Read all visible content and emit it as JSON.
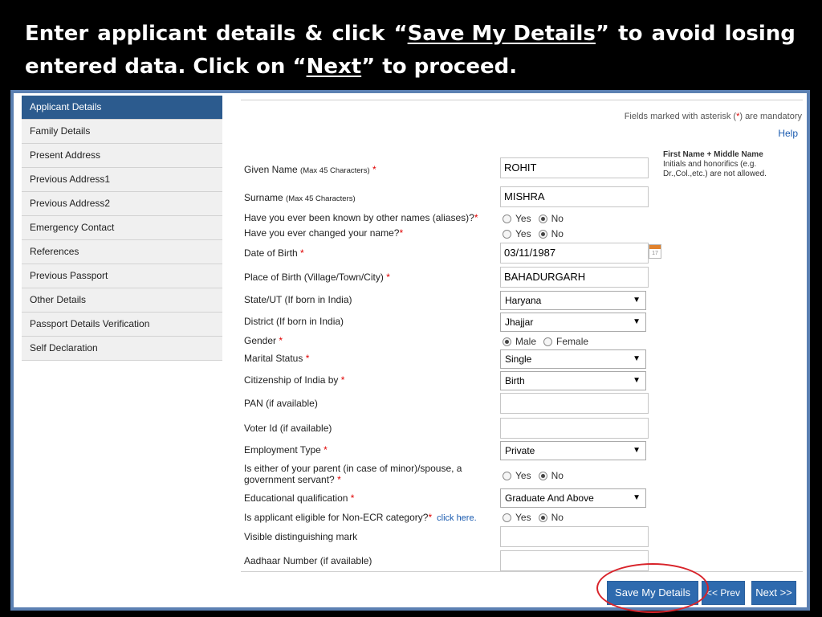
{
  "banner": {
    "line1_words": [
      "Enter",
      "applicant",
      "details",
      "&",
      "click",
      "“",
      "Save My Details",
      "”",
      "to",
      "avoid",
      "losing"
    ],
    "line2_pre": "entered data. Click on “",
    "line2_link": "Next",
    "line2_post": "” to proceed."
  },
  "sidebar": {
    "items": [
      {
        "label": "Applicant Details",
        "active": true
      },
      {
        "label": "Family Details"
      },
      {
        "label": "Present Address"
      },
      {
        "label": "Previous Address1"
      },
      {
        "label": "Previous Address2"
      },
      {
        "label": "Emergency Contact"
      },
      {
        "label": "References"
      },
      {
        "label": "Previous Passport"
      },
      {
        "label": "Other Details"
      },
      {
        "label": "Passport Details Verification"
      },
      {
        "label": "Self Declaration"
      }
    ]
  },
  "header": {
    "mandatory_pre": "Fields marked with asterisk (",
    "mandatory_ast": "*",
    "mandatory_post": ") are mandatory",
    "help": "Help"
  },
  "note": {
    "title": "First Name + Middle Name",
    "body": "Initials and honorifics (e.g. Dr.,Col.,etc.) are not allowed."
  },
  "form": {
    "given_name": {
      "label": "Given Name",
      "hint": "(Max 45 Characters)",
      "value": "ROHIT"
    },
    "surname": {
      "label": "Surname",
      "hint": "(Max 45 Characters)",
      "value": "MISHRA"
    },
    "aliases": {
      "label": "Have you ever been known by other names (aliases)?",
      "selected": "No"
    },
    "changed_name": {
      "label": "Have you ever changed your name?",
      "selected": "No"
    },
    "dob": {
      "label": "Date of Birth",
      "value": "03/11/1987",
      "calendar_icon": "calendar-icon"
    },
    "place_of_birth": {
      "label": "Place of Birth (Village/Town/City)",
      "value": "BAHADURGARH"
    },
    "state": {
      "label": "State/UT (If born in India)",
      "value": "Haryana"
    },
    "district": {
      "label": "District (If born in India)",
      "value": "Jhajjar"
    },
    "gender": {
      "label": "Gender",
      "options": [
        "Male",
        "Female"
      ],
      "selected": "Male"
    },
    "marital_status": {
      "label": "Marital Status",
      "value": "Single"
    },
    "citizenship": {
      "label": "Citizenship of India by",
      "value": "Birth"
    },
    "pan": {
      "label": "PAN (if available)",
      "value": ""
    },
    "voter_id": {
      "label": "Voter Id (if available)",
      "value": ""
    },
    "employment": {
      "label": "Employment Type",
      "value": "Private"
    },
    "parent_govt": {
      "label": "Is either of your parent (in case of minor)/spouse, a government servant?",
      "selected": "No"
    },
    "education": {
      "label": "Educational qualification",
      "value": "Graduate And Above"
    },
    "non_ecr": {
      "label": "Is applicant eligible for Non-ECR category?",
      "link": "click here.",
      "selected": "No"
    },
    "mark": {
      "label": "Visible distinguishing mark",
      "value": ""
    },
    "aadhaar": {
      "label": "Aadhaar Number (if available)",
      "value": ""
    },
    "yes_label": "Yes",
    "no_label": "No",
    "required_mark": "*"
  },
  "buttons": {
    "save": "Save My Details",
    "prev": "<< Prev",
    "next": "Next >>"
  },
  "colors": {
    "active_nav": "#2c5b8e",
    "button": "#2e6aae",
    "frame": "#5b80b2",
    "highlight_circle": "#d8232a"
  }
}
